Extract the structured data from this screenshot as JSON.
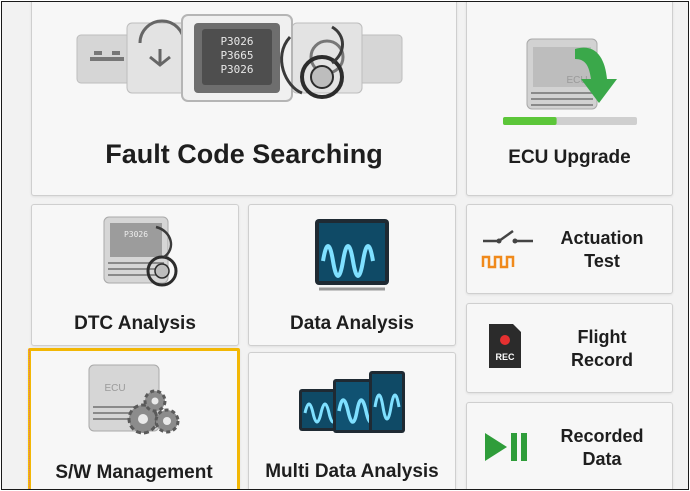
{
  "tiles": {
    "fault_code": {
      "label": "Fault Code Searching",
      "codes": [
        "P3026",
        "P3665",
        "P3026"
      ]
    },
    "ecu_upgrade": {
      "label": "ECU Upgrade",
      "chip_text": "ECU",
      "progress": 0.4
    },
    "dtc": {
      "label": "DTC Analysis",
      "codes": [
        "P3026"
      ]
    },
    "data_analysis": {
      "label": "Data Analysis"
    },
    "actuation": {
      "label_line1": "Actuation",
      "label_line2": "Test"
    },
    "flight_record": {
      "label_line1": "Flight",
      "label_line2": "Record",
      "rec_text": "REC"
    },
    "sw_management": {
      "label": "S/W Management",
      "chip_text": "ECU"
    },
    "multi_data": {
      "label": "Multi Data Analysis"
    },
    "recorded_data": {
      "label_line1": "Recorded",
      "label_line2": "Data"
    }
  },
  "colors": {
    "selected_border": "#f2b705",
    "progress_green": "#5cc639",
    "arrow_green": "#3aa84a",
    "screen_blue": "#39a6d8",
    "rec_red": "#e53030"
  }
}
